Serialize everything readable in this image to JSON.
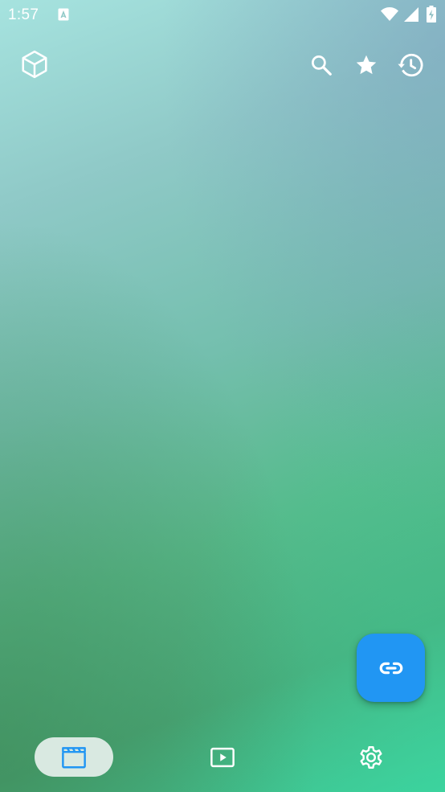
{
  "status_bar": {
    "time": "1:57",
    "icons": [
      "notification-icon",
      "wifi-icon",
      "cellular-signal-icon",
      "battery-charging-icon"
    ]
  },
  "app_bar": {
    "logo_icon": "cube-icon",
    "actions": [
      "search-icon",
      "star-icon",
      "history-icon"
    ]
  },
  "fab": {
    "icon": "link-icon",
    "color": "#2196f3"
  },
  "bottom_nav": {
    "items": [
      {
        "icon": "clapperboard-icon",
        "selected": true
      },
      {
        "icon": "play-box-icon",
        "selected": false
      },
      {
        "icon": "gear-icon",
        "selected": false
      }
    ],
    "accent": "#2196f3"
  }
}
